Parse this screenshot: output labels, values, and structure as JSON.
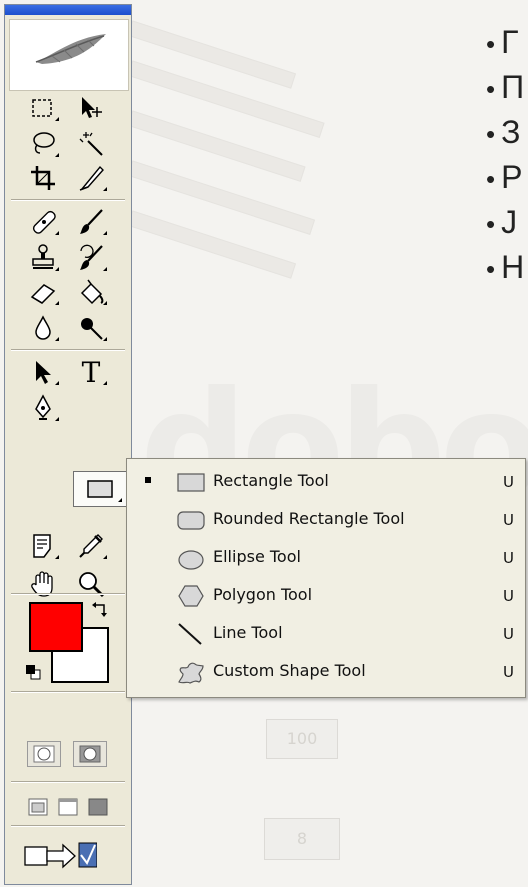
{
  "slide": {
    "bullets": [
      "Г",
      "П",
      "З",
      "Р",
      "J",
      "Н"
    ],
    "bg_fragments": {
      "box1": "100",
      "box2": "8"
    }
  },
  "toolbox": {
    "foreground_color": "#ff0000",
    "background_color": "#ffffff",
    "tools": [
      {
        "name": "rectangular-marquee",
        "icon": "marquee-icon"
      },
      {
        "name": "move",
        "icon": "move-icon"
      },
      {
        "name": "lasso",
        "icon": "lasso-icon"
      },
      {
        "name": "magic-wand",
        "icon": "magic-wand-icon"
      },
      {
        "name": "crop",
        "icon": "crop-icon"
      },
      {
        "name": "slice",
        "icon": "slice-icon"
      },
      {
        "name": "healing-brush",
        "icon": "bandage-icon"
      },
      {
        "name": "brush",
        "icon": "brush-icon"
      },
      {
        "name": "clone-stamp",
        "icon": "stamp-icon"
      },
      {
        "name": "history-brush",
        "icon": "history-brush-icon"
      },
      {
        "name": "eraser",
        "icon": "eraser-icon"
      },
      {
        "name": "paint-bucket",
        "icon": "bucket-icon"
      },
      {
        "name": "blur",
        "icon": "drop-icon"
      },
      {
        "name": "dodge",
        "icon": "dodge-icon"
      },
      {
        "name": "path-selection",
        "icon": "arrow-icon"
      },
      {
        "name": "type",
        "icon": "type-icon",
        "glyph": "T"
      },
      {
        "name": "pen",
        "icon": "pen-icon"
      },
      {
        "name": "shape",
        "icon": "rectangle-icon"
      },
      {
        "name": "notes",
        "icon": "notes-icon"
      },
      {
        "name": "eyedropper",
        "icon": "eyedropper-icon"
      },
      {
        "name": "hand",
        "icon": "hand-icon"
      },
      {
        "name": "zoom",
        "icon": "magnifier-icon"
      }
    ]
  },
  "flyout": {
    "items": [
      {
        "label": "Rectangle Tool",
        "shortcut": "U",
        "selected": true,
        "icon": "rectangle-shape-icon"
      },
      {
        "label": "Rounded Rectangle Tool",
        "shortcut": "U",
        "selected": false,
        "icon": "rounded-rectangle-icon"
      },
      {
        "label": "Ellipse Tool",
        "shortcut": "U",
        "selected": false,
        "icon": "ellipse-icon"
      },
      {
        "label": "Polygon Tool",
        "shortcut": "U",
        "selected": false,
        "icon": "polygon-icon"
      },
      {
        "label": "Line Tool",
        "shortcut": "U",
        "selected": false,
        "icon": "line-icon"
      },
      {
        "label": "Custom Shape Tool",
        "shortcut": "U",
        "selected": false,
        "icon": "custom-shape-icon"
      }
    ]
  }
}
